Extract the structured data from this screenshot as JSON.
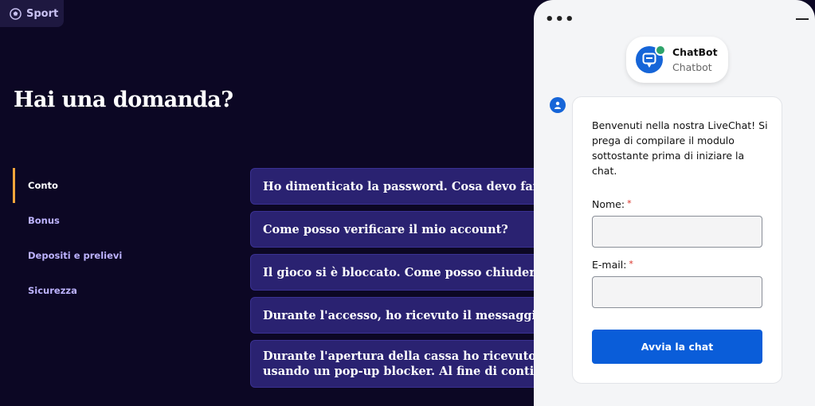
{
  "nav": {
    "sport_label": "Sport"
  },
  "page": {
    "title": "Hai una domanda?"
  },
  "categories": [
    {
      "label": "Conto",
      "active": true
    },
    {
      "label": "Bonus",
      "active": false
    },
    {
      "label": "Depositi e prelievi",
      "active": false
    },
    {
      "label": "Sicurezza",
      "active": false
    }
  ],
  "faq": [
    {
      "line1": "Ho dimenticato la password. Cosa devo fare?"
    },
    {
      "line1": "Come posso verificare il mio account?"
    },
    {
      "line1": "Il gioco si è bloccato. Come posso chiudere Spingra"
    },
    {
      "line1": "Durante l'accesso, ho ricevuto il messaggio di erro"
    },
    {
      "line1": "Durante l'apertura della cassa ho ricevuto il messa",
      "line2": "usando un pop-up blocker. Al fine di continuare a g"
    }
  ],
  "chat": {
    "menu_icon": "ellipsis-icon",
    "minimize_icon": "minimize-icon",
    "bot_name": "ChatBot",
    "bot_subtitle": "Chatbot",
    "welcome": "Benvenuti nella nostra LiveChat! Si prega di compilare il modulo sottostante prima di iniziare la chat.",
    "name_label": "Nome:",
    "email_label": "E-mail:",
    "required_mark": "*",
    "name_value": "",
    "email_value": "",
    "start_button": "Avvia la chat",
    "colors": {
      "accent": "#0a5dd9",
      "online": "#2ea36a",
      "required": "#d93025"
    }
  },
  "colors": {
    "background": "#0c0724",
    "faq_bg": "#2a2271",
    "active_marker": "#f2a53b",
    "category_text": "#bdb3ff"
  }
}
